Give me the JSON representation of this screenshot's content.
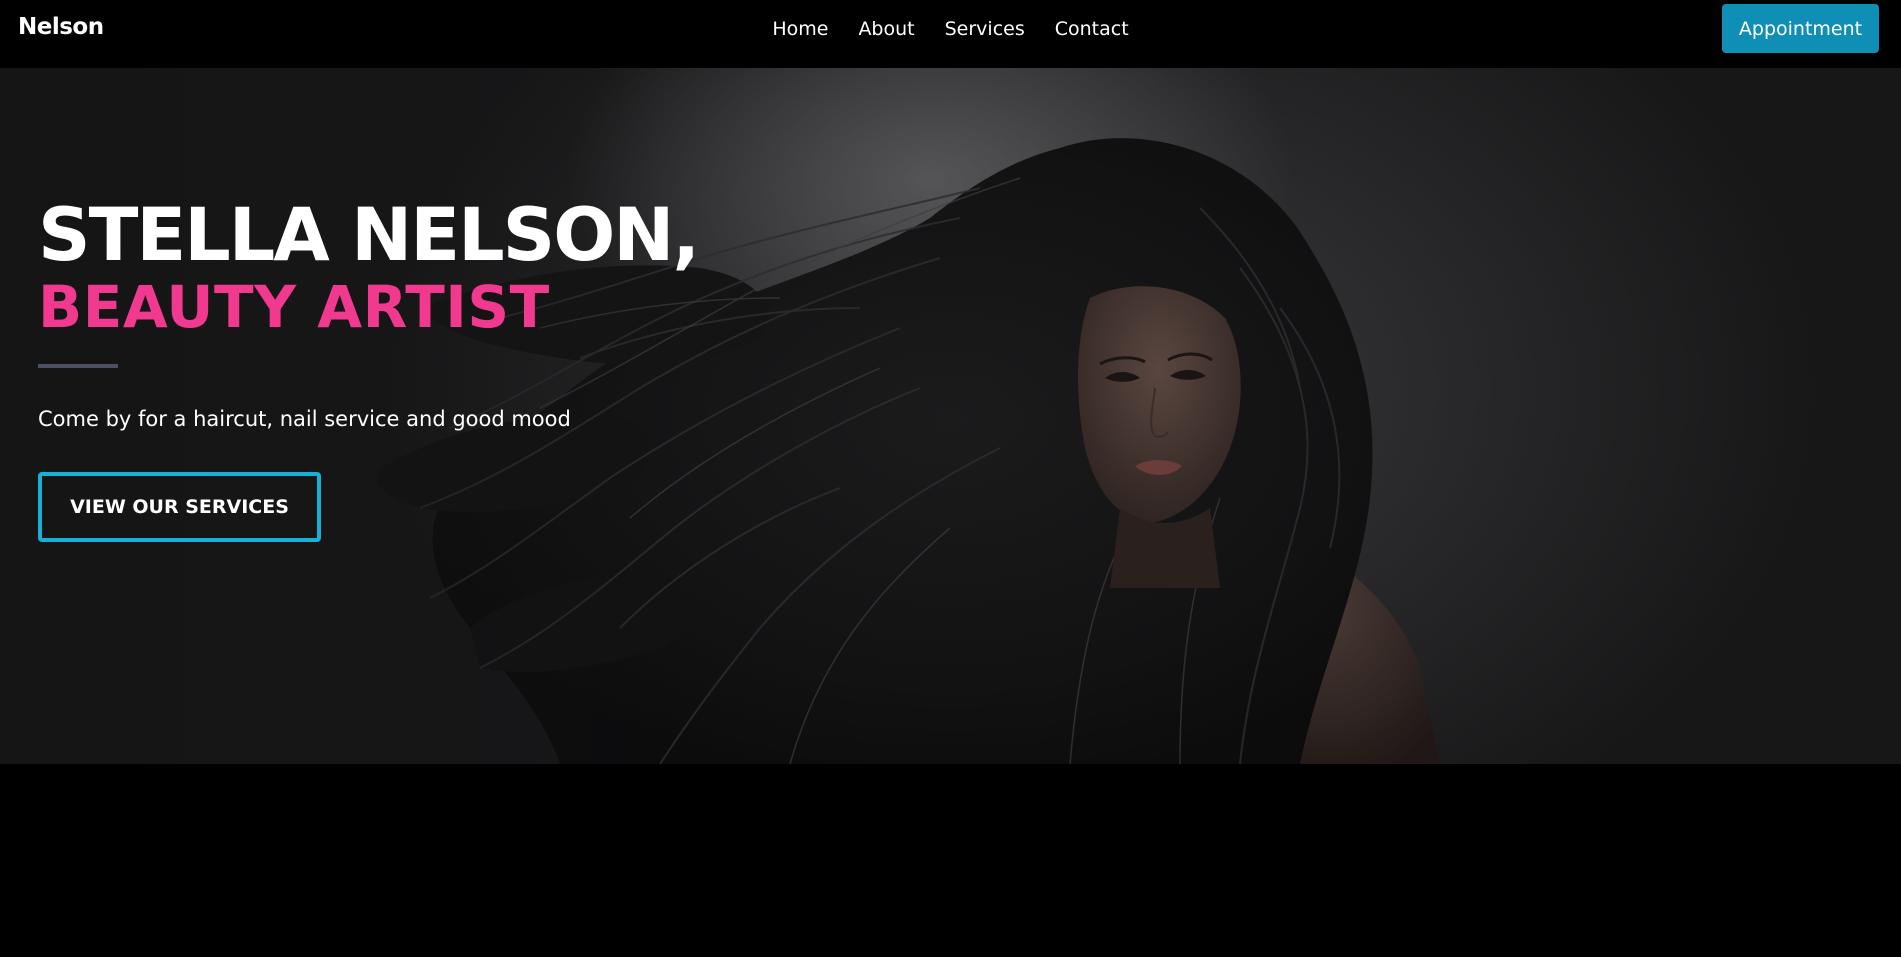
{
  "nav": {
    "brand": "Nelson",
    "links": [
      "Home",
      "About",
      "Services",
      "Contact"
    ],
    "appointment_label": "Appointment"
  },
  "hero": {
    "title_line1": "STELLA NELSON,",
    "title_line2": "BEAUTY ARTIST",
    "tagline": "Come by for a haircut, nail service and good mood",
    "cta_label": "VIEW OUR SERVICES",
    "image_subject": "woman-with-long-flowing-dark-hair"
  },
  "colors": {
    "accent_pink": "#f0398f",
    "accent_blue": "#0f8fb5",
    "button_border": "#17b0d6",
    "divider": "#4a5063",
    "background": "#000000"
  }
}
